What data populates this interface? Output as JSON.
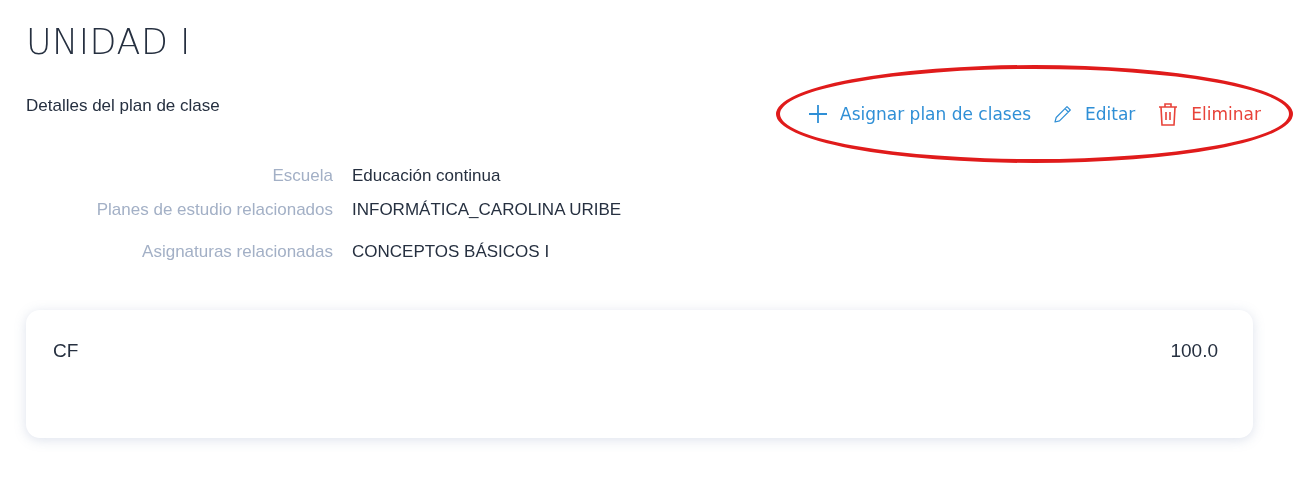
{
  "title": "UNIDAD I",
  "subtitle": "Detalles del plan de clase",
  "actions": [
    {
      "kind": "add",
      "label": "Asignar plan de clases"
    },
    {
      "kind": "edit",
      "label": "Editar"
    },
    {
      "kind": "delete",
      "label": "Eliminar"
    }
  ],
  "annotations": [
    {
      "kind": "ellipse"
    }
  ],
  "details": [
    {
      "label": "Escuela",
      "value": "Educación continua"
    },
    {
      "label": "Planes de estudio relacionados",
      "value": "INFORMÁTICA_CAROLINA URIBE"
    },
    {
      "label": "Asignaturas relacionadas",
      "value": "CONCEPTOS BÁSICOS I"
    }
  ],
  "card": {
    "name": "CF",
    "value": "100.0"
  }
}
